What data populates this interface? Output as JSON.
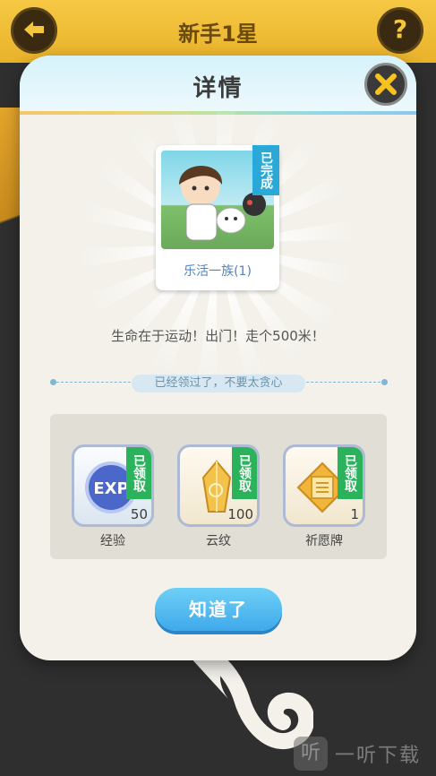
{
  "background": {
    "title": "新手1星",
    "back_icon": "arrow-left-icon",
    "help_label": "?"
  },
  "modal": {
    "title": "详情",
    "close_icon": "close-icon",
    "achievement": {
      "name": "乐活一族(1)",
      "status_badge": "已完成"
    },
    "description": "生命在于运动！出门！走个500米！",
    "notice": "已经领过了，不要太贪心",
    "rewards": [
      {
        "name": "经验",
        "count": "50",
        "status": "已领取",
        "icon": "exp-icon"
      },
      {
        "name": "云纹",
        "count": "100",
        "status": "已领取",
        "icon": "crystal-icon"
      },
      {
        "name": "祈愿牌",
        "count": "1",
        "status": "已领取",
        "icon": "wish-plaque-icon"
      }
    ],
    "confirm_label": "知道了"
  },
  "watermark": "一听下载",
  "colors": {
    "accent_blue": "#3fa9ea",
    "claimed_green": "#2bb35b",
    "badge_blue": "#2aa8d8",
    "close_yellow": "#f6c21c"
  }
}
